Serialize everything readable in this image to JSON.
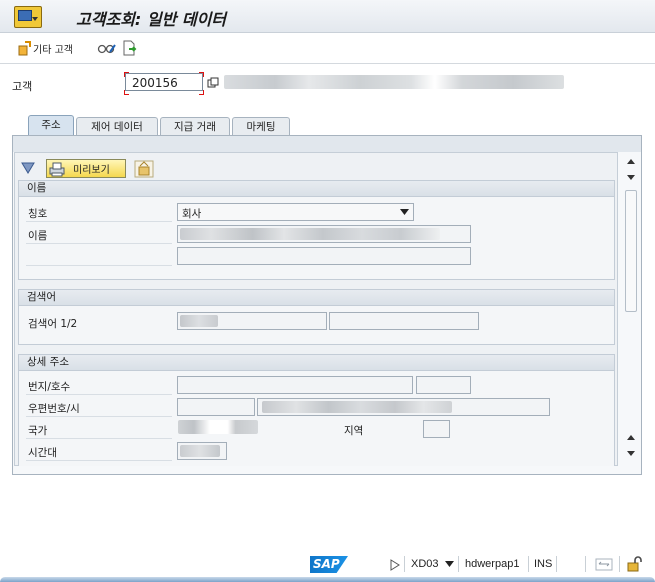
{
  "window": {
    "title": "고객조회: 일반 데이터"
  },
  "toolbar": {
    "other_customer_label": "기타 고객"
  },
  "customer": {
    "label": "고객",
    "value": "200156"
  },
  "tabs": [
    {
      "label": "주소",
      "active": true
    },
    {
      "label": "제어 데이터",
      "active": false
    },
    {
      "label": "지급 거래",
      "active": false
    },
    {
      "label": "마케팅",
      "active": false
    }
  ],
  "panel_toolbar": {
    "preview_label": "미리보기"
  },
  "section_name": {
    "title": "이름",
    "salutation_label": "칭호",
    "salutation_value": "회사",
    "name_label": "이름"
  },
  "section_search": {
    "title": "검색어",
    "search_term_label": "검색어 1/2"
  },
  "section_address": {
    "title": "상세 주소",
    "street_label": "번지/호수",
    "postal_city_label": "우편번호/시",
    "country_label": "국가",
    "region_label": "지역",
    "timezone_label": "시간대"
  },
  "status": {
    "system": "XD03",
    "server": "hdwerpap1",
    "mode": "INS"
  },
  "colors": {
    "accent": "#0f76c9",
    "title_bg": "#e3e8ee",
    "tab_active": "#d7e3ef"
  },
  "icons": [
    "app-menu-icon",
    "other-customer-icon",
    "glasses-icon",
    "document-arrow-icon",
    "duplicate-icon",
    "sort-icon",
    "print-icon",
    "package-icon",
    "scroll-up-icon",
    "scroll-down-icon",
    "play-icon",
    "dropdown-icon",
    "layout-icon",
    "lock-icon"
  ]
}
